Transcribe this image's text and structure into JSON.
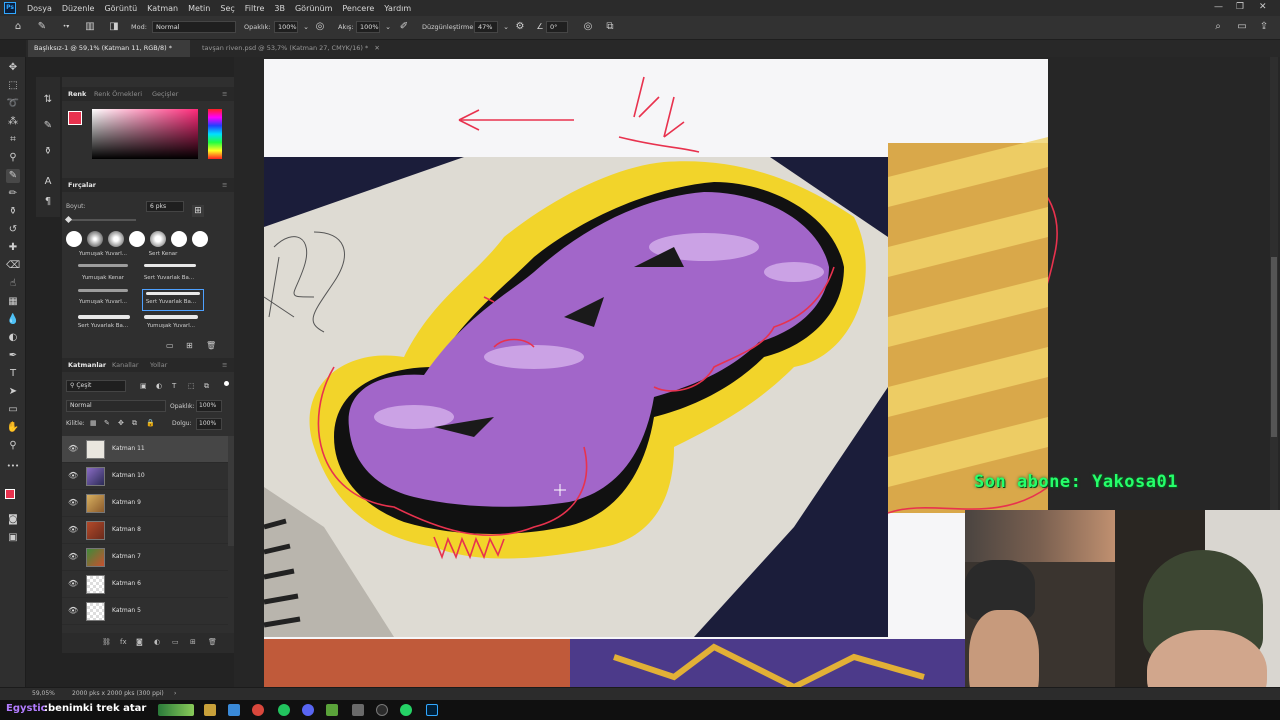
{
  "menubar": {
    "app_badge": "Ps",
    "items": [
      "Dosya",
      "Düzenle",
      "Görüntü",
      "Katman",
      "Metin",
      "Seç",
      "Filtre",
      "3B",
      "Görünüm",
      "Pencere",
      "Yardım"
    ],
    "window_controls": [
      "—",
      "❐",
      "✕"
    ]
  },
  "options": {
    "mode_label": "Mod:",
    "mode_value": "Normal",
    "opacity_label": "Opaklık:",
    "opacity_value": "100%",
    "flow_label": "Akış:",
    "flow_value": "100%",
    "smoothing_label": "Düzgünleştirme:",
    "smoothing_value": "47%",
    "angle_value": "0°"
  },
  "tabs": [
    {
      "label": "Başlıksız-1 @ 59,1% (Katman 11, RGB/8) *",
      "active": true
    },
    {
      "label": "tavşan riven.psd @ 53,7% (Katman 27, CMYK/16) *",
      "active": false
    }
  ],
  "color_panel": {
    "tabs": [
      "Renk",
      "Renk Örnekleri",
      "Geçişler"
    ],
    "foreground": "#e8324e",
    "hue": "#ff2a7a"
  },
  "brushes_panel": {
    "title": "Fırçalar",
    "size_label": "Boyut:",
    "size_value": "6 pks",
    "presets": [
      "Yumuşak Yuvarl...",
      "Sert Kenar",
      "Yumuşak Kenar",
      "Sert Yuvarlak Ba...",
      "Yumuşak Yuvarl...",
      "Sert Yuvarlak Ba...",
      "Sert Yuvarlak Ba...",
      "Yumuşak Yuvarl..."
    ]
  },
  "layers_panel": {
    "tabs": [
      "Katmanlar",
      "Kanallar",
      "Yollar"
    ],
    "filter_label": "Çeşit",
    "blend_mode": "Normal",
    "opacity_label": "Opaklık:",
    "opacity_value": "100%",
    "lock_label": "Kilitle:",
    "fill_label": "Dolgu:",
    "fill_value": "100%",
    "layers": [
      {
        "name": "Katman 11",
        "selected": true
      },
      {
        "name": "Katman 10",
        "selected": false
      },
      {
        "name": "Katman 9",
        "selected": false
      },
      {
        "name": "Katman 8",
        "selected": false
      },
      {
        "name": "Katman 7",
        "selected": false
      },
      {
        "name": "Katman 6",
        "selected": false
      },
      {
        "name": "Katman 5",
        "selected": false
      }
    ]
  },
  "status": {
    "zoom": "59,05%",
    "doc_size": "2000 pks x 2000 pks (300 ppi)"
  },
  "stream": {
    "subscriber_text": "Son abone: Yakosa01",
    "chat_user": "Egystic",
    "chat_message": ":benimki trek atar"
  }
}
